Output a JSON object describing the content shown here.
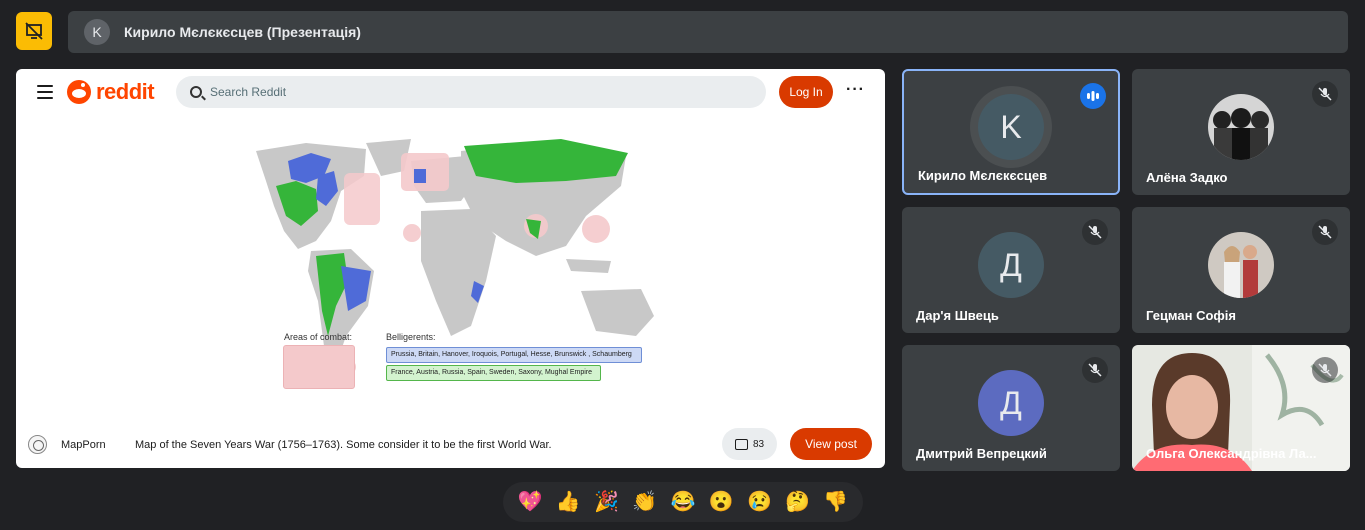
{
  "top": {
    "presenter_initial": "K",
    "presentation_title": "Кирило Мєлєкєсцев (Презентація)"
  },
  "reddit": {
    "logo_text": "reddit",
    "search_placeholder": "Search Reddit",
    "login_label": "Log In",
    "more_label": "···"
  },
  "map": {
    "areas_label": "Areas of combat:",
    "belligerents_label": "Belligerents:",
    "side_blue": "Prussia, Britain, Hanover, Iroquois, Portugal, Hesse, Brunswick , Schaumberg",
    "side_green": "France, Austria, Russia, Spain, Sweden, Saxony, Mughal Empire",
    "colors": {
      "blue": "#4f6bd8",
      "green": "#35b53a",
      "combat": "#f4c9cb",
      "land": "#c8c8c8"
    }
  },
  "post": {
    "subreddit": "MapPorn",
    "title": "Map of the Seven Years War (1756–1763). Some consider it to be the first World War.",
    "comment_count": "83",
    "view_post_label": "View post"
  },
  "participants": [
    {
      "name": "Кирило Мєлєкєсцев",
      "initial": "K",
      "avatar_color": "#455a64",
      "mic": "speaking",
      "active": true
    },
    {
      "name": "Алёна Задко",
      "initial": "",
      "avatar_color": "",
      "mic": "muted",
      "active": false,
      "photo": true
    },
    {
      "name": "Дар'я Швець",
      "initial": "Д",
      "avatar_color": "#455a64",
      "mic": "muted",
      "active": false
    },
    {
      "name": "Гецман Софія",
      "initial": "",
      "avatar_color": "",
      "mic": "muted",
      "active": false,
      "photo": true
    },
    {
      "name": "Дмитрий Вепрецкий",
      "initial": "Д",
      "avatar_color": "#5c6bc0",
      "mic": "muted",
      "active": false
    },
    {
      "name": "Ольга Олександрівна Ла...",
      "initial": "",
      "avatar_color": "",
      "mic": "muted",
      "active": false,
      "video": true
    }
  ],
  "reactions": [
    "💖",
    "👍",
    "🎉",
    "👏",
    "😂",
    "😮",
    "😢",
    "🤔",
    "👎"
  ]
}
